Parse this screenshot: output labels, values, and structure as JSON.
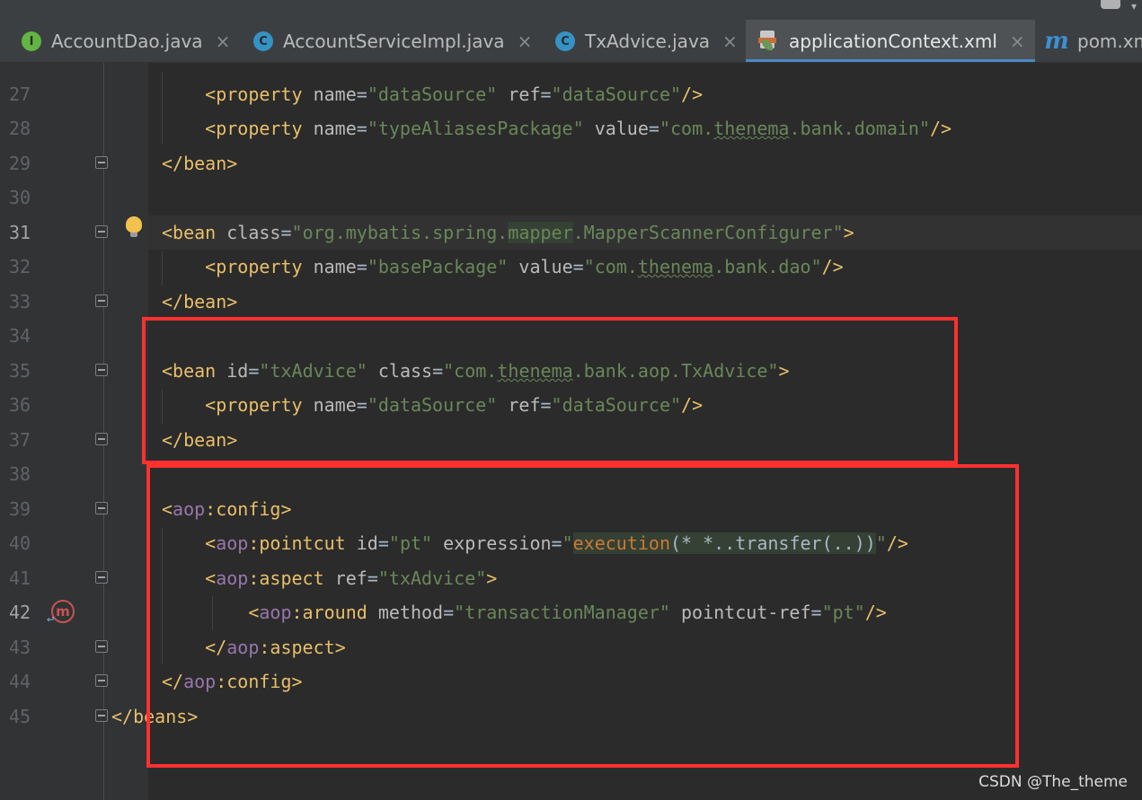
{
  "tabs": [
    {
      "label": "AccountDao.java",
      "icon": "interface-icon",
      "active": false
    },
    {
      "label": "AccountServiceImpl.java",
      "icon": "class-icon",
      "active": false
    },
    {
      "label": "TxAdvice.java",
      "icon": "class-icon",
      "active": false
    },
    {
      "label": "applicationContext.xml",
      "icon": "xml-file-icon",
      "active": true
    },
    {
      "label": "pom.xm",
      "icon": "maven-icon",
      "active": false
    }
  ],
  "close_glyph": "×",
  "line_numbers": [
    "27",
    "28",
    "29",
    "30",
    "31",
    "32",
    "33",
    "34",
    "35",
    "36",
    "37",
    "38",
    "39",
    "40",
    "41",
    "42",
    "43",
    "44",
    "45"
  ],
  "current_line": "42",
  "code": {
    "l27": {
      "open": "<",
      "tag": "property",
      "a1": "name",
      "eq1": "=",
      "v1": "\"dataSource\"",
      "a2": "ref",
      "eq2": "=",
      "v2": "\"dataSource\"",
      "close": "/>"
    },
    "l28": {
      "open": "<",
      "tag": "property",
      "a1": "name",
      "eq1": "=",
      "v1": "\"typeAliasesPackage\"",
      "a2": "value",
      "eq2": "=",
      "v2a": "\"com.",
      "v2b": "thenema",
      "v2c": ".bank.domain\"",
      "close": "/>"
    },
    "l29": {
      "text": "</bean>"
    },
    "l31": {
      "open": "<",
      "tag": "bean",
      "a1": "class",
      "eq1": "=",
      "v1a": "\"org.mybatis.spring.",
      "v1b": "mapper",
      "v1c": ".MapperScannerConfigurer\"",
      "close": ">"
    },
    "l32": {
      "open": "<",
      "tag": "property",
      "a1": "name",
      "eq1": "=",
      "v1": "\"basePackage\"",
      "a2": "value",
      "eq2": "=",
      "v2a": "\"com.",
      "v2b": "thenema",
      "v2c": ".bank.dao\"",
      "close": "/>"
    },
    "l33": {
      "text": "</bean>"
    },
    "l35": {
      "open": "<",
      "tag": "bean",
      "a1": "id",
      "eq1": "=",
      "v1": "\"txAdvice\"",
      "a2": "class",
      "eq2": "=",
      "v2a": "\"com.",
      "v2b": "thenema",
      "v2c": ".bank.aop.TxAdvice\"",
      "close": ">"
    },
    "l36": {
      "open": "<",
      "tag": "property",
      "a1": "name",
      "eq1": "=",
      "v1": "\"dataSource\"",
      "a2": "ref",
      "eq2": "=",
      "v2": "\"dataSource\"",
      "close": "/>"
    },
    "l37": {
      "text": "</bean>"
    },
    "l39": {
      "open": "<",
      "ns": "aop",
      "local": ":config",
      "close": ">"
    },
    "l40": {
      "open": "<",
      "ns": "aop",
      "local": ":pointcut",
      "a1": "id",
      "eq1": "=",
      "v1": "\"pt\"",
      "a2": "expression",
      "eq2": "=",
      "q": "\"",
      "exec": "execution",
      "expr": "(* *..transfer(..))",
      "q2": "\"",
      "close": "/>"
    },
    "l41": {
      "open": "<",
      "ns": "aop",
      "local": ":aspect",
      "a1": "ref",
      "eq1": "=",
      "v1": "\"txAdvice\"",
      "close": ">"
    },
    "l42": {
      "open": "<",
      "ns": "aop",
      "local": ":around",
      "a1": "method",
      "eq1": "=",
      "v1": "\"transactionManager\"",
      "a2": "pointcut-ref",
      "eq2": "=",
      "v2": "\"pt\"",
      "close": "/>"
    },
    "l43": {
      "open": "</",
      "ns": "aop",
      "local": ":aspect",
      "close": ">"
    },
    "l44": {
      "open": "</",
      "ns": "aop",
      "local": ":config",
      "close": ">"
    },
    "l45": {
      "text": "</beans>"
    }
  },
  "gutter_icons": {
    "intention": "lightbulb-icon",
    "mapper": "mybatis-mapper-icon",
    "fold": "fold-marker-icon"
  },
  "annotation_color": "#ff3030",
  "watermark": "CSDN @The_theme"
}
